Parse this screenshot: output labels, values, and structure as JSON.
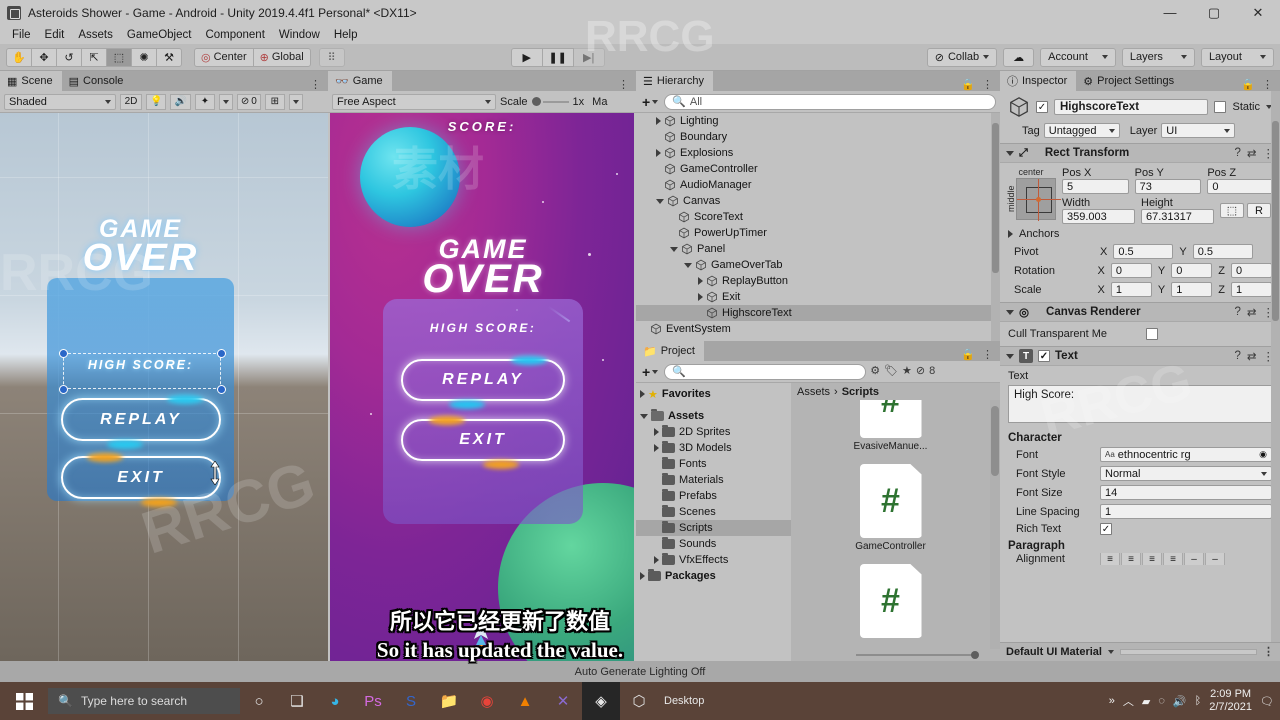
{
  "window": {
    "title": "Asteroids Shower - Game - Android - Unity 2019.4.4f1 Personal* <DX11>",
    "minimize": "—",
    "maximize": "▢",
    "close": "✕"
  },
  "menubar": {
    "items": [
      "File",
      "Edit",
      "Assets",
      "GameObject",
      "Component",
      "Window",
      "Help"
    ]
  },
  "toolbar": {
    "tools": [
      {
        "name": "hand-tool",
        "glyph": "✋"
      },
      {
        "name": "move-tool",
        "glyph": "✥"
      },
      {
        "name": "rotate-tool",
        "glyph": "↺"
      },
      {
        "name": "scale-tool",
        "glyph": "⇱"
      },
      {
        "name": "rect-tool",
        "glyph": "⬚"
      },
      {
        "name": "transform-tool",
        "glyph": "✺"
      },
      {
        "name": "custom-tool",
        "glyph": "⚒"
      }
    ],
    "pivot_label": "Center",
    "space_label": "Global",
    "grid_snap_glyph": "⠿",
    "play": "▶",
    "pause": "❚❚",
    "step": "▶|",
    "collab_label": "Collab",
    "cloud_glyph": "☁",
    "account_label": "Account",
    "layers_label": "Layers",
    "layout_label": "Layout"
  },
  "scene_panel": {
    "tabs": [
      {
        "label": "Scene",
        "icon": "grid-icon",
        "active": true
      },
      {
        "label": "Console",
        "icon": "console-icon",
        "active": false
      }
    ],
    "shading_mode": "Shaded",
    "mode_2d": "2D",
    "lighting_glyph": "💡",
    "audio_glyph": "🔊",
    "fx_glyph": "✦",
    "hidden_count": "0",
    "gizmos_glyph": "⊞",
    "game_overlay": {
      "game_over_line1": "GAME",
      "game_over_line2": "OVER",
      "high_score": "HIGH SCORE:",
      "replay": "REPLAY",
      "exit": "EXIT"
    }
  },
  "game_panel": {
    "tab_label": "Game",
    "aspect": "Free Aspect",
    "scale_label": "Scale",
    "scale_value": "1x",
    "maximize_label": "Ma",
    "overlay": {
      "score": "SCORE:",
      "game_over_line1": "GAME",
      "game_over_line2": "OVER",
      "high_score": "HIGH SCORE:",
      "replay": "REPLAY",
      "exit": "EXIT"
    }
  },
  "hierarchy": {
    "tab_label": "Hierarchy",
    "add_label": "+",
    "search_placeholder": "All",
    "items": [
      {
        "label": "Lighting",
        "indent": 1,
        "arrow": "right",
        "selected": false
      },
      {
        "label": "Boundary",
        "indent": 1,
        "arrow": "none",
        "selected": false
      },
      {
        "label": "Explosions",
        "indent": 1,
        "arrow": "right",
        "selected": false
      },
      {
        "label": "GameController",
        "indent": 1,
        "arrow": "none",
        "selected": false
      },
      {
        "label": "AudioManager",
        "indent": 1,
        "arrow": "none",
        "selected": false
      },
      {
        "label": "Canvas",
        "indent": 1,
        "arrow": "down",
        "selected": false
      },
      {
        "label": "ScoreText",
        "indent": 2,
        "arrow": "none",
        "selected": false
      },
      {
        "label": "PowerUpTimer",
        "indent": 2,
        "arrow": "none",
        "selected": false
      },
      {
        "label": "Panel",
        "indent": 2,
        "arrow": "down",
        "selected": false
      },
      {
        "label": "GameOverTab",
        "indent": 3,
        "arrow": "down",
        "selected": false
      },
      {
        "label": "ReplayButton",
        "indent": 4,
        "arrow": "right",
        "selected": false
      },
      {
        "label": "Exit",
        "indent": 4,
        "arrow": "right",
        "selected": false
      },
      {
        "label": "HighscoreText",
        "indent": 4,
        "arrow": "none",
        "selected": true
      },
      {
        "label": "EventSystem",
        "indent": 0,
        "arrow": "none",
        "selected": false
      }
    ]
  },
  "project": {
    "tab_label": "Project",
    "add_label": "+",
    "search_placeholder": "",
    "badge_count": "8",
    "favorites_label": "Favorites",
    "tree": [
      {
        "label": "Assets",
        "indent": 0,
        "arrow": "down",
        "bold": true,
        "selected": false
      },
      {
        "label": "2D Sprites",
        "indent": 1,
        "arrow": "right",
        "bold": false,
        "selected": false
      },
      {
        "label": "3D Models",
        "indent": 1,
        "arrow": "right",
        "bold": false,
        "selected": false
      },
      {
        "label": "Fonts",
        "indent": 1,
        "arrow": "none",
        "bold": false,
        "selected": false
      },
      {
        "label": "Materials",
        "indent": 1,
        "arrow": "none",
        "bold": false,
        "selected": false
      },
      {
        "label": "Prefabs",
        "indent": 1,
        "arrow": "none",
        "bold": false,
        "selected": false
      },
      {
        "label": "Scenes",
        "indent": 1,
        "arrow": "none",
        "bold": false,
        "selected": false
      },
      {
        "label": "Scripts",
        "indent": 1,
        "arrow": "none",
        "bold": false,
        "selected": true
      },
      {
        "label": "Sounds",
        "indent": 1,
        "arrow": "none",
        "bold": false,
        "selected": false
      },
      {
        "label": "VfxEffects",
        "indent": 1,
        "arrow": "right",
        "bold": false,
        "selected": false
      },
      {
        "label": "Packages",
        "indent": 0,
        "arrow": "right",
        "bold": true,
        "selected": false
      }
    ],
    "breadcrumb": [
      "Assets",
      "Scripts"
    ],
    "breadcrumb_sep": "›",
    "assets": [
      {
        "label": "EvasiveManue...",
        "icon": "csharp-script-icon"
      },
      {
        "label": "GameController",
        "icon": "csharp-script-icon"
      },
      {
        "label": "",
        "icon": "csharp-script-icon"
      }
    ],
    "script_glyph": "#"
  },
  "inspector": {
    "tabs": [
      {
        "label": "Inspector",
        "icon": "info-icon",
        "active": true
      },
      {
        "label": "Project Settings",
        "icon": "gear-icon",
        "active": false
      }
    ],
    "object_enabled": "✓",
    "object_name": "HighscoreText",
    "static_label": "Static",
    "static_checked": false,
    "tag_label": "Tag",
    "tag_value": "Untagged",
    "layer_label": "Layer",
    "layer_value": "UI",
    "rect_transform": {
      "title": "Rect Transform",
      "anchor_preset_h": "center",
      "anchor_preset_v": "middle",
      "pos_x_label": "Pos X",
      "pos_x": "5",
      "pos_y_label": "Pos Y",
      "pos_y": "73",
      "pos_z_label": "Pos Z",
      "pos_z": "0",
      "width_label": "Width",
      "width": "359.003",
      "height_label": "Height",
      "height": "67.31317",
      "blueprint_glyph": "⬚",
      "raw_label": "R",
      "anchors_label": "Anchors",
      "pivot_label": "Pivot",
      "pivot_x": "0.5",
      "pivot_y": "0.5",
      "rotation_label": "Rotation",
      "rot_x": "0",
      "rot_y": "0",
      "rot_z": "0",
      "scale_label": "Scale",
      "scale_x": "1",
      "scale_y": "1",
      "scale_z": "1"
    },
    "canvas_renderer": {
      "title": "Canvas Renderer",
      "cull_label": "Cull Transparent Me",
      "cull_checked": false
    },
    "text_component": {
      "title": "Text",
      "enabled": "✓",
      "text_label": "Text",
      "text_value": "High Score:",
      "character_label": "Character",
      "font_label": "Font",
      "font_value": "ethnocentric rg",
      "font_style_label": "Font Style",
      "font_style_value": "Normal",
      "font_size_label": "Font Size",
      "font_size_value": "14",
      "line_spacing_label": "Line Spacing",
      "line_spacing_value": "1",
      "rich_text_label": "Rich Text",
      "rich_text_checked": true,
      "paragraph_label": "Paragraph",
      "alignment_label": "Alignment"
    },
    "material_footer": "Default UI Material"
  },
  "statusbar": {
    "text": "Auto Generate Lighting Off"
  },
  "subtitles": {
    "chinese": "所以它已经更新了数值",
    "english": "So it has updated the value."
  },
  "taskbar": {
    "start_glyph": "⊞",
    "search_placeholder": "Type here to search",
    "cortana_glyph": "○",
    "taskview_glyph": "❑",
    "apps": [
      "edge",
      "photoshop",
      "skype",
      "explorer",
      "chrome",
      "vlc",
      "vscode",
      "unity",
      "unity-hub"
    ],
    "desktop_label": "Desktop",
    "overflow_glyph": "»",
    "chevron_glyph": "︿",
    "battery_glyph": "▰",
    "network_glyph": "◌",
    "volume_glyph": "🔊",
    "time": "2:09 PM",
    "date": "2/7/2021"
  }
}
